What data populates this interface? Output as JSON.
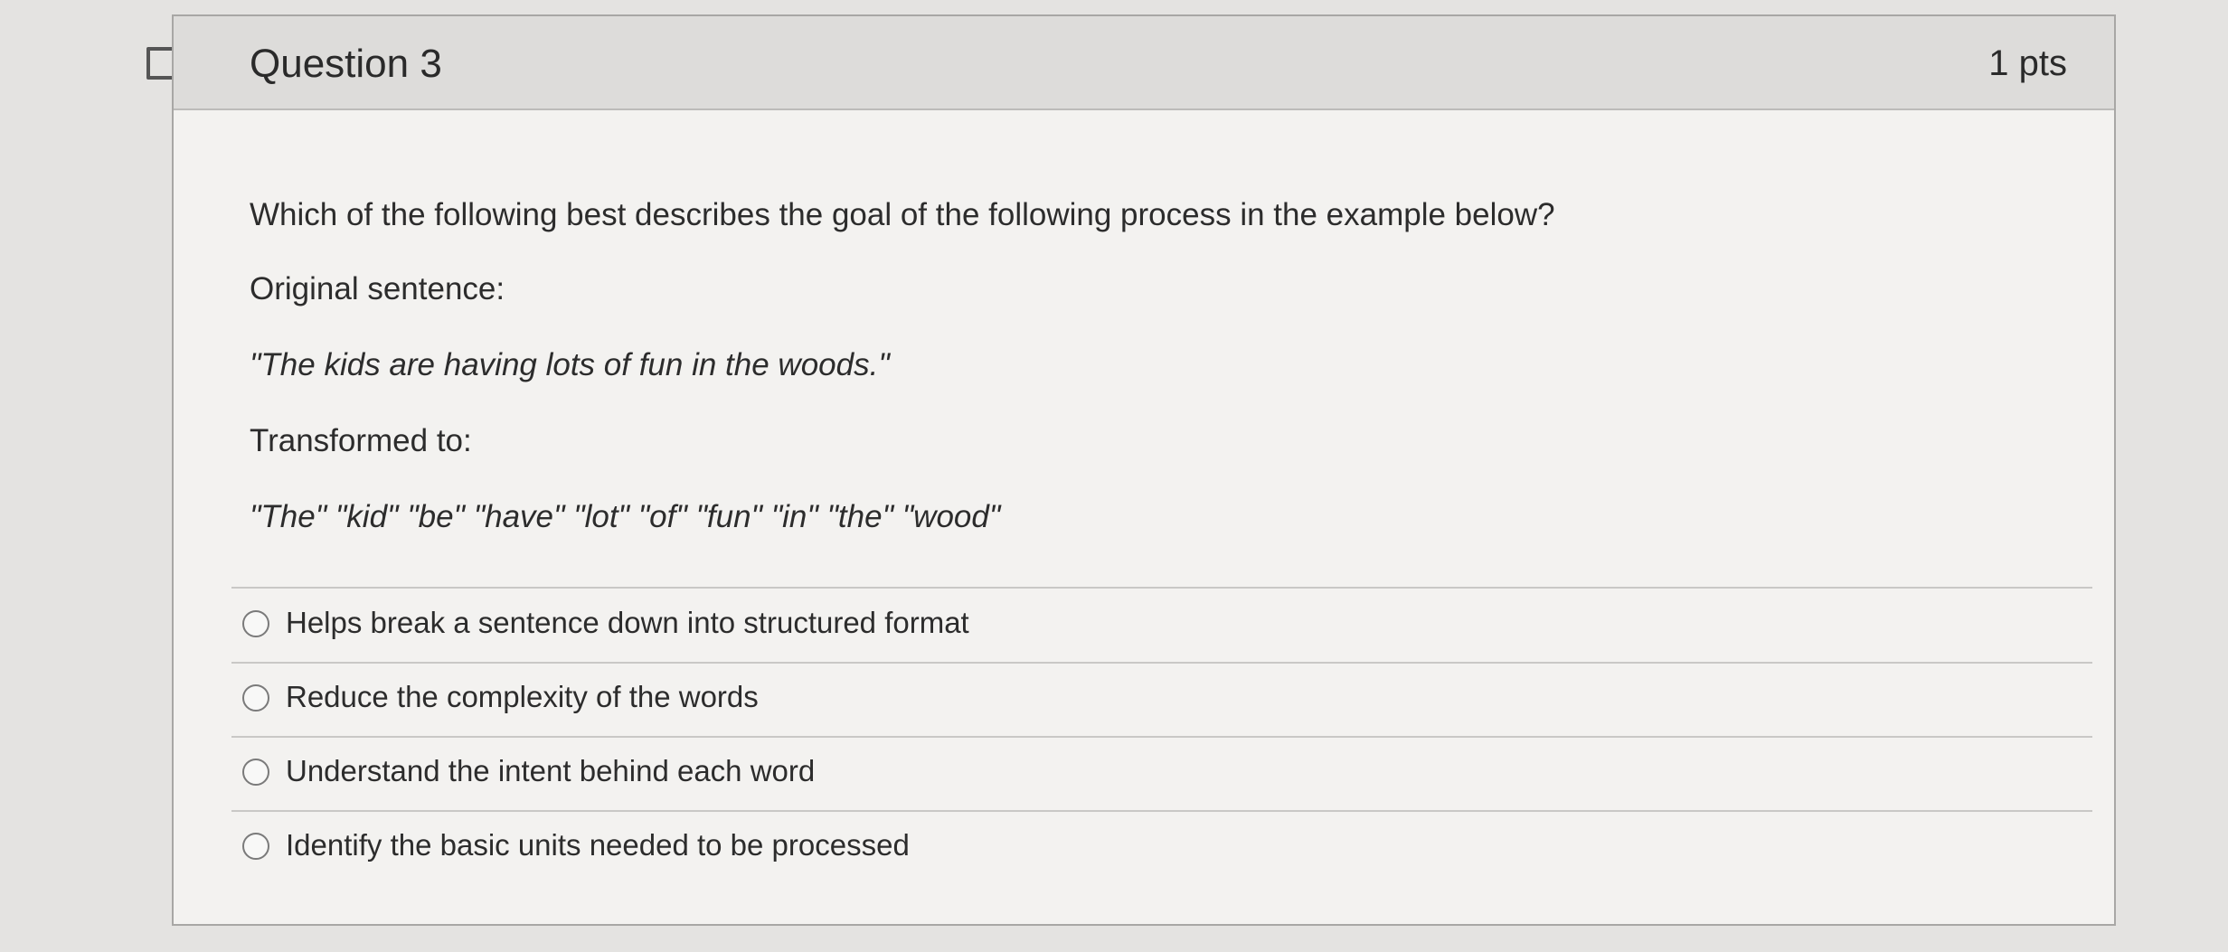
{
  "question": {
    "title": "Question 3",
    "points": "1 pts",
    "prompt": "Which of the following best describes the goal of the following process in the example below?",
    "original_label": "Original sentence:",
    "original_sentence": "\"The kids are having lots of fun in the woods.\"",
    "transformed_label": "Transformed to:",
    "transformed_tokens": "\"The\"  \"kid\"  \"be\"  \"have\"  \"lot\"  \"of\"  \"fun\"  \"in\"  \"the\" \"wood\""
  },
  "answers": [
    {
      "label": "Helps break a sentence down into structured format",
      "selected": false
    },
    {
      "label": "Reduce the complexity of the words",
      "selected": false
    },
    {
      "label": "Understand the intent behind each word",
      "selected": false
    },
    {
      "label": "Identify the basic units needed to be processed",
      "selected": false
    }
  ],
  "icons": {
    "flag": "flag-icon",
    "radio": "radio-button"
  },
  "colors": {
    "header_bg": "#dddcda",
    "card_bg": "#f3f2f0",
    "text": "#2c2c2c"
  }
}
